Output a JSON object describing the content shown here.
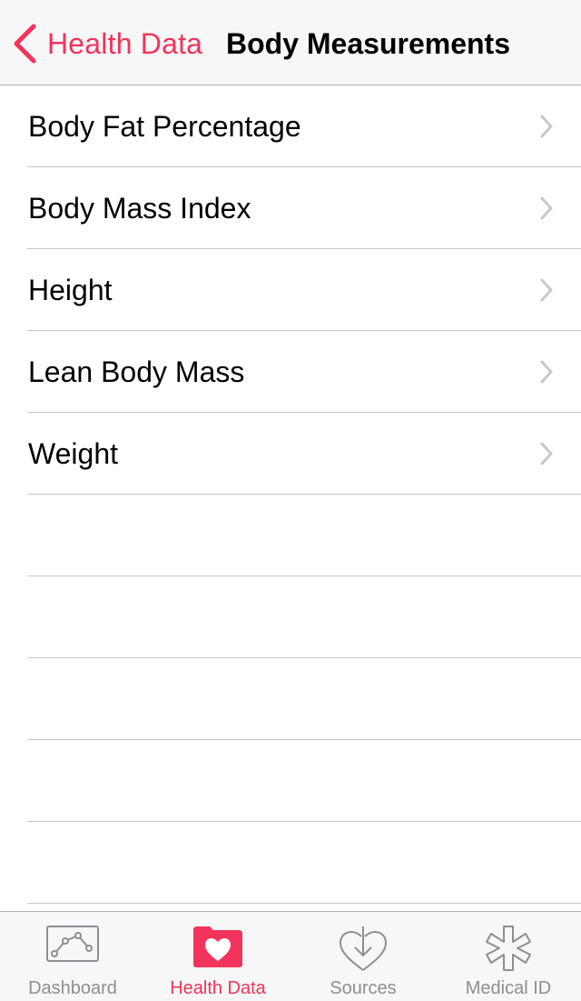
{
  "nav": {
    "back_label": "Health Data",
    "title": "Body Measurements"
  },
  "list": {
    "items": [
      {
        "label": "Body Fat Percentage"
      },
      {
        "label": "Body Mass Index"
      },
      {
        "label": "Height"
      },
      {
        "label": "Lean Body Mass"
      },
      {
        "label": "Weight"
      }
    ]
  },
  "tabs": [
    {
      "label": "Dashboard",
      "icon": "dashboard-icon",
      "active": false
    },
    {
      "label": "Health Data",
      "icon": "health-data-icon",
      "active": true
    },
    {
      "label": "Sources",
      "icon": "sources-icon",
      "active": false
    },
    {
      "label": "Medical ID",
      "icon": "medical-id-icon",
      "active": false
    }
  ],
  "colors": {
    "accent": "#f2335b",
    "inactive": "#8e8e93",
    "separator": "#c8c7cc",
    "bar_background": "#f7f7f7"
  }
}
